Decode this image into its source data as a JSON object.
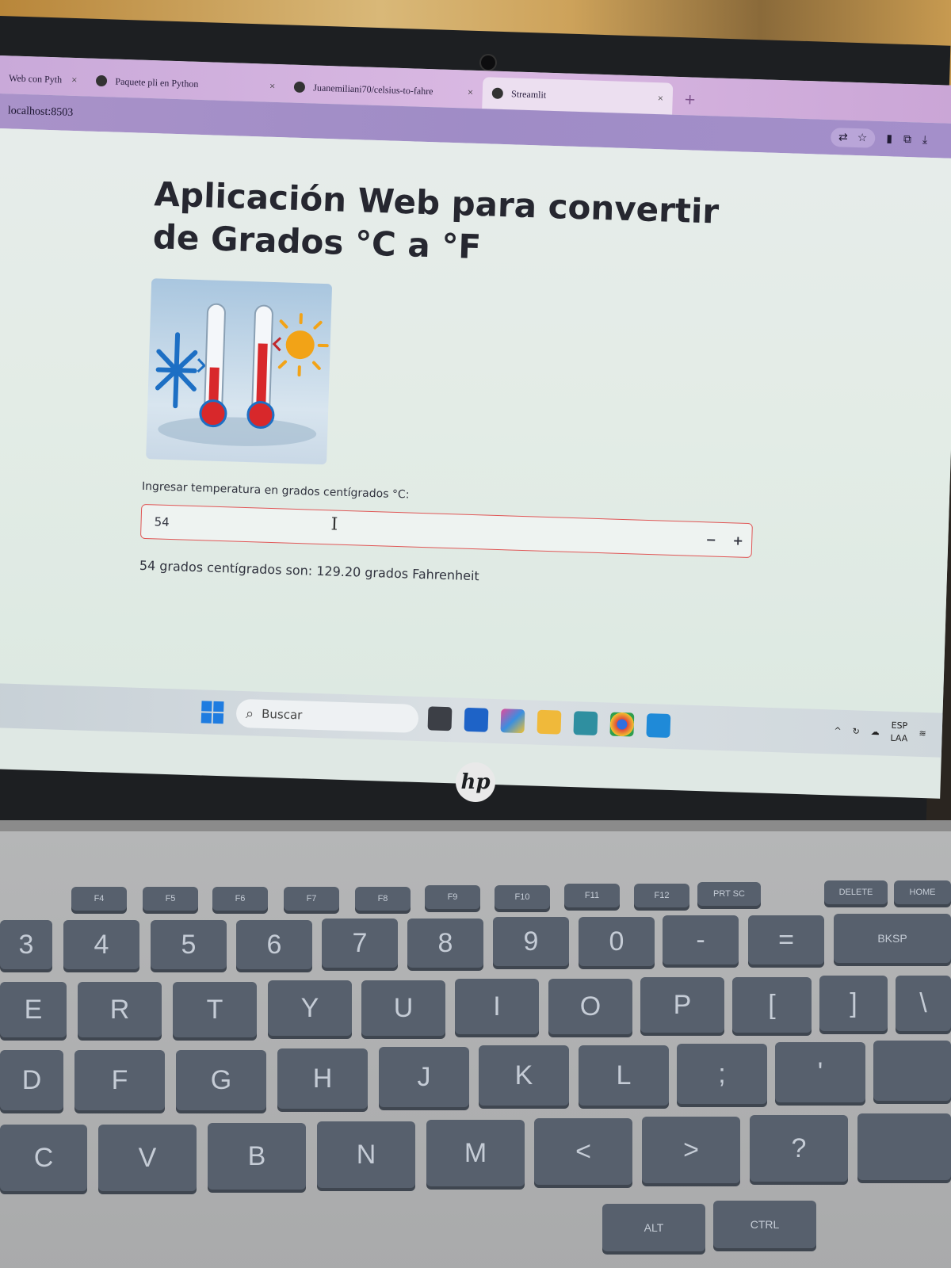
{
  "browser": {
    "tabs": [
      {
        "label": "Web con Pyth",
        "close": "×"
      },
      {
        "label": "Paquete pli en Python",
        "close": "×"
      },
      {
        "label": "Juanemiliani70/celsius-to-fahre",
        "close": "×"
      },
      {
        "label": "Streamlit",
        "close": "×"
      }
    ],
    "new_tab": "+",
    "url": "localhost:8503"
  },
  "app": {
    "title": "Aplicación Web para convertir de Grados °C a °F",
    "input_label": "Ingresar temperatura en grados centígrados °C:",
    "input_value": "54",
    "minus": "−",
    "plus": "+",
    "result": "54 grados centígrados son: 129.20 grados Fahrenheit"
  },
  "taskbar": {
    "search_placeholder": "Buscar",
    "lang_top": "ESP",
    "lang_bottom": "LAA"
  },
  "laptop": {
    "brand": "hp"
  },
  "keyboard": {
    "fn_row": [
      "F4",
      "F5",
      "F6",
      "F7",
      "F8",
      "F9",
      "F10",
      "F11",
      "F12",
      "PRT SC",
      "DELETE",
      "HOME"
    ],
    "number_row": [
      "3",
      "4",
      "5",
      "6",
      "7",
      "8",
      "9",
      "0",
      "-",
      "=",
      "BKSP"
    ],
    "top_row": [
      "E",
      "R",
      "T",
      "Y",
      "U",
      "I",
      "O",
      "P",
      "[",
      "]",
      "\\"
    ],
    "home_row": [
      "D",
      "F",
      "G",
      "H",
      "J",
      "K",
      "L",
      ";",
      "'"
    ],
    "bottom_row": [
      "C",
      "V",
      "B",
      "N",
      "M",
      "<",
      ">",
      "?"
    ],
    "mod_keys": [
      "ALT",
      "CTRL"
    ]
  }
}
